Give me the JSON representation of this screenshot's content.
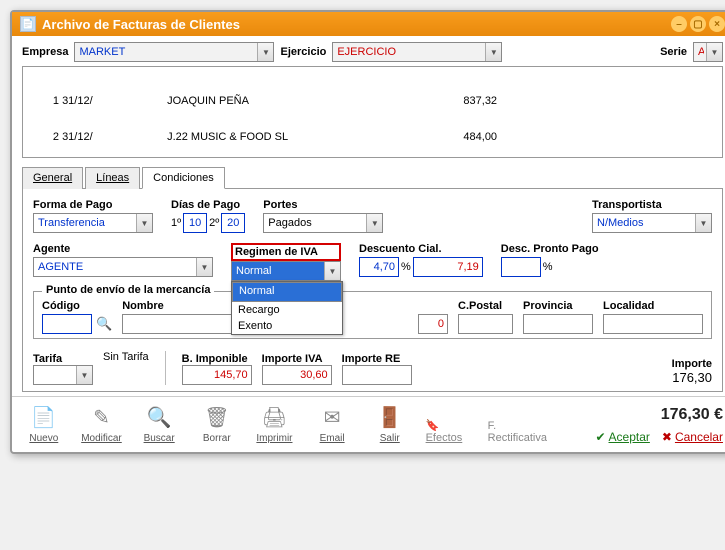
{
  "titlebar": {
    "title": "Archivo de Facturas de Clientes"
  },
  "top": {
    "empresa_label": "Empresa",
    "empresa_value": "MARKET",
    "ejercicio_label": "Ejercicio",
    "ejercicio_value": "EJERCICIO",
    "serie_label": "Serie",
    "serie_value": "A"
  },
  "list": {
    "rows": [
      {
        "num": "1",
        "date": "31/12/",
        "code": "",
        "name": "JOAQUIN PEÑA",
        "amount": "837,32"
      },
      {
        "num": "2",
        "date": "31/12/",
        "code": "",
        "name": "J.22 MUSIC & FOOD SL",
        "amount": "484,00"
      }
    ]
  },
  "tabs": {
    "general": "General",
    "lineas": "Líneas",
    "condiciones": "Condiciones"
  },
  "cond": {
    "forma_pago_label": "Forma de Pago",
    "forma_pago_value": "Transferencia",
    "dias_pago_label": "Días de Pago",
    "dias1_label": "1º",
    "dias1_value": "10",
    "dias2_label": "2º",
    "dias2_value": "20",
    "portes_label": "Portes",
    "portes_value": "Pagados",
    "transportista_label": "Transportista",
    "transportista_value": "N/Medios",
    "agente_label": "Agente",
    "agente_value": "AGENTE",
    "regimen_label": "Regimen de IVA",
    "regimen_value": "Normal",
    "regimen_options": [
      "Normal",
      "Recargo",
      "Exento"
    ],
    "desc_cial_label": "Descuento Cial.",
    "desc_cial_pct": "4,70",
    "desc_cial_amt": "7,19",
    "desc_pp_label": "Desc. Pronto Pago",
    "desc_pp_pct": "",
    "ship_title": "Punto de envío de la mercancía",
    "ship_codigo_label": "Código",
    "ship_codigo": "",
    "ship_nombre_label": "Nombre",
    "ship_nombre": "",
    "ship_qty": "0",
    "ship_cpostal_label": "C.Postal",
    "ship_cpostal": "",
    "ship_provincia_label": "Provincia",
    "ship_provincia": "",
    "ship_localidad_label": "Localidad",
    "ship_localidad": "",
    "tarifa_label": "Tarifa",
    "tarifa_text": "Sin Tarifa",
    "bimponible_label": "B. Imponible",
    "bimponible": "145,70",
    "importe_iva_label": "Importe IVA",
    "importe_iva": "30,60",
    "importe_re_label": "Importe RE",
    "importe_re": "",
    "importe_label": "Importe",
    "importe": "176,30"
  },
  "toolbar": {
    "nuevo": "Nuevo",
    "modificar": "Modificar",
    "buscar": "Buscar",
    "borrar": "Borrar",
    "imprimir": "Imprimir",
    "email": "Email",
    "salir": "Salir",
    "efectos": "Efectos",
    "rectificativa": "F. Rectificativa",
    "total": "176,30 €",
    "aceptar": "Aceptar",
    "cancelar": "Cancelar"
  }
}
